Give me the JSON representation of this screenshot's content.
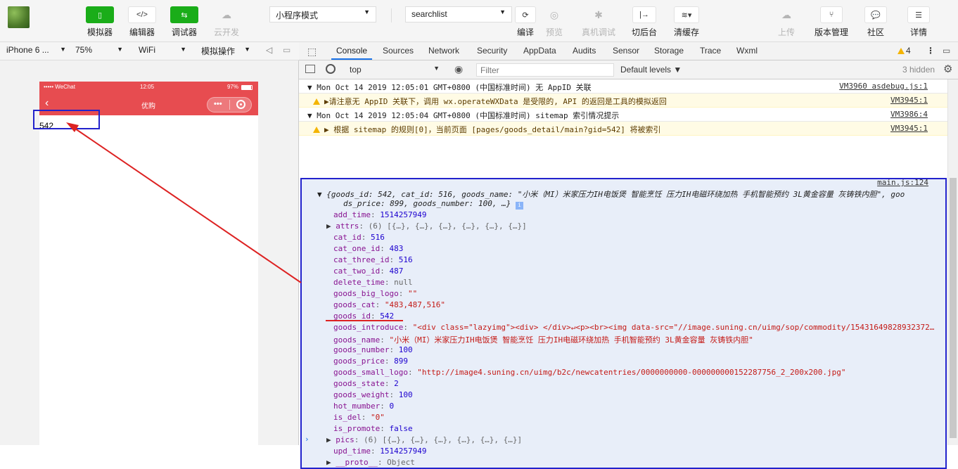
{
  "toolbar": {
    "simulator": "模拟器",
    "editor": "编辑器",
    "debugger": "调试器",
    "cloud": "云开发",
    "mode_select": "小程序模式",
    "compile_select": "searchlist",
    "compile": "编译",
    "preview": "预览",
    "remote_debug": "真机调试",
    "background": "切后台",
    "clear_cache": "清缓存",
    "upload": "上传",
    "version": "版本管理",
    "community": "社区",
    "details": "详情"
  },
  "simbar": {
    "device": "iPhone 6 ...",
    "zoom": "75%",
    "network": "WiFi",
    "simulate_ops": "模拟操作"
  },
  "phone": {
    "carrier": "••••• WeChat",
    "time": "12:05",
    "battery": "97%",
    "title": "优购",
    "content": "542"
  },
  "devtools": {
    "tabs": [
      "Console",
      "Sources",
      "Network",
      "Security",
      "AppData",
      "Audits",
      "Sensor",
      "Storage",
      "Trace",
      "Wxml"
    ],
    "warn_count": "4",
    "context": "top",
    "filter_placeholder": "Filter",
    "levels": "Default levels",
    "hidden": "3 hidden"
  },
  "console": {
    "l1": {
      "text": "Mon Oct 14 2019 12:05:01 GMT+0800 (中国标准时间) 无 AppID 关联",
      "src": "VM3960 asdebug.js:1"
    },
    "l2": {
      "text": "请注意无 AppID 关联下，调用 wx.operateWXData 是受限的, API 的返回是工具的模拟返回",
      "src": "VM3945:1"
    },
    "l3": {
      "text": "Mon Oct 14 2019 12:05:04 GMT+0800 (中国标准时间) sitemap 索引情况提示",
      "src": "VM3986:4"
    },
    "l4": {
      "text": "根据 sitemap 的规则[0]，当前页面 [pages/goods_detail/main?gid=542] 将被索引",
      "src": "VM3945:1"
    },
    "obj_src": "main.js:124",
    "obj_summary1": "{goods_id: 542, cat_id: 516, goods_name: \"小米（MI）米家压力IH电饭煲 智能烹饪 压力IH电磁环绕加热 手机智能预约 3L黄金容量 灰铸铁内胆\", goo",
    "obj_summary2": "ds_price: 899, goods_number: 100, …}",
    "props": [
      {
        "k": "add_time",
        "v": "1514257949",
        "t": "n"
      },
      {
        "k": "attrs",
        "v": "(6) [{…}, {…}, {…}, {…}, {…}, {…}]",
        "t": "g",
        "exp": true
      },
      {
        "k": "cat_id",
        "v": "516",
        "t": "n"
      },
      {
        "k": "cat_one_id",
        "v": "483",
        "t": "n"
      },
      {
        "k": "cat_three_id",
        "v": "516",
        "t": "n"
      },
      {
        "k": "cat_two_id",
        "v": "487",
        "t": "n"
      },
      {
        "k": "delete_time",
        "v": "null",
        "t": "g"
      },
      {
        "k": "goods_big_logo",
        "v": "\"\"",
        "t": "s"
      },
      {
        "k": "goods_cat",
        "v": "\"483,487,516\"",
        "t": "s"
      },
      {
        "k": "goods_id",
        "v": "542",
        "t": "n"
      },
      {
        "k": "goods_introduce",
        "v": "\"<div class=\"lazyimg\"><div> </div>↵<p><br><img data-src=\"//image.suning.cn/uimg/sop/commodity/15431649828932372…",
        "t": "s"
      },
      {
        "k": "goods_name",
        "v": "\"小米（MI）米家压力IH电饭煲 智能烹饪 压力IH电磁环绕加热 手机智能预约 3L黄金容量 灰铸铁内胆\"",
        "t": "s"
      },
      {
        "k": "goods_number",
        "v": "100",
        "t": "n"
      },
      {
        "k": "goods_price",
        "v": "899",
        "t": "n"
      },
      {
        "k": "goods_small_logo",
        "v": "\"http://image4.suning.cn/uimg/b2c/newcatentries/0000000000-000000000152287756_2_200x200.jpg\"",
        "t": "s"
      },
      {
        "k": "goods_state",
        "v": "2",
        "t": "n"
      },
      {
        "k": "goods_weight",
        "v": "100",
        "t": "n"
      },
      {
        "k": "hot_mumber",
        "v": "0",
        "t": "n"
      },
      {
        "k": "is_del",
        "v": "\"0\"",
        "t": "s"
      },
      {
        "k": "is_promote",
        "v": "false",
        "t": "n"
      },
      {
        "k": "pics",
        "v": "(6) [{…}, {…}, {…}, {…}, {…}, {…}]",
        "t": "g",
        "exp": true
      },
      {
        "k": "upd_time",
        "v": "1514257949",
        "t": "n"
      },
      {
        "k": "__proto__",
        "v": "Object",
        "t": "g",
        "exp": true
      }
    ]
  },
  "colors": {
    "wechat_green": "#1aad19",
    "nav_red": "#e74c50",
    "annot_blue": "#2222cc",
    "annot_red": "#dd2222"
  }
}
